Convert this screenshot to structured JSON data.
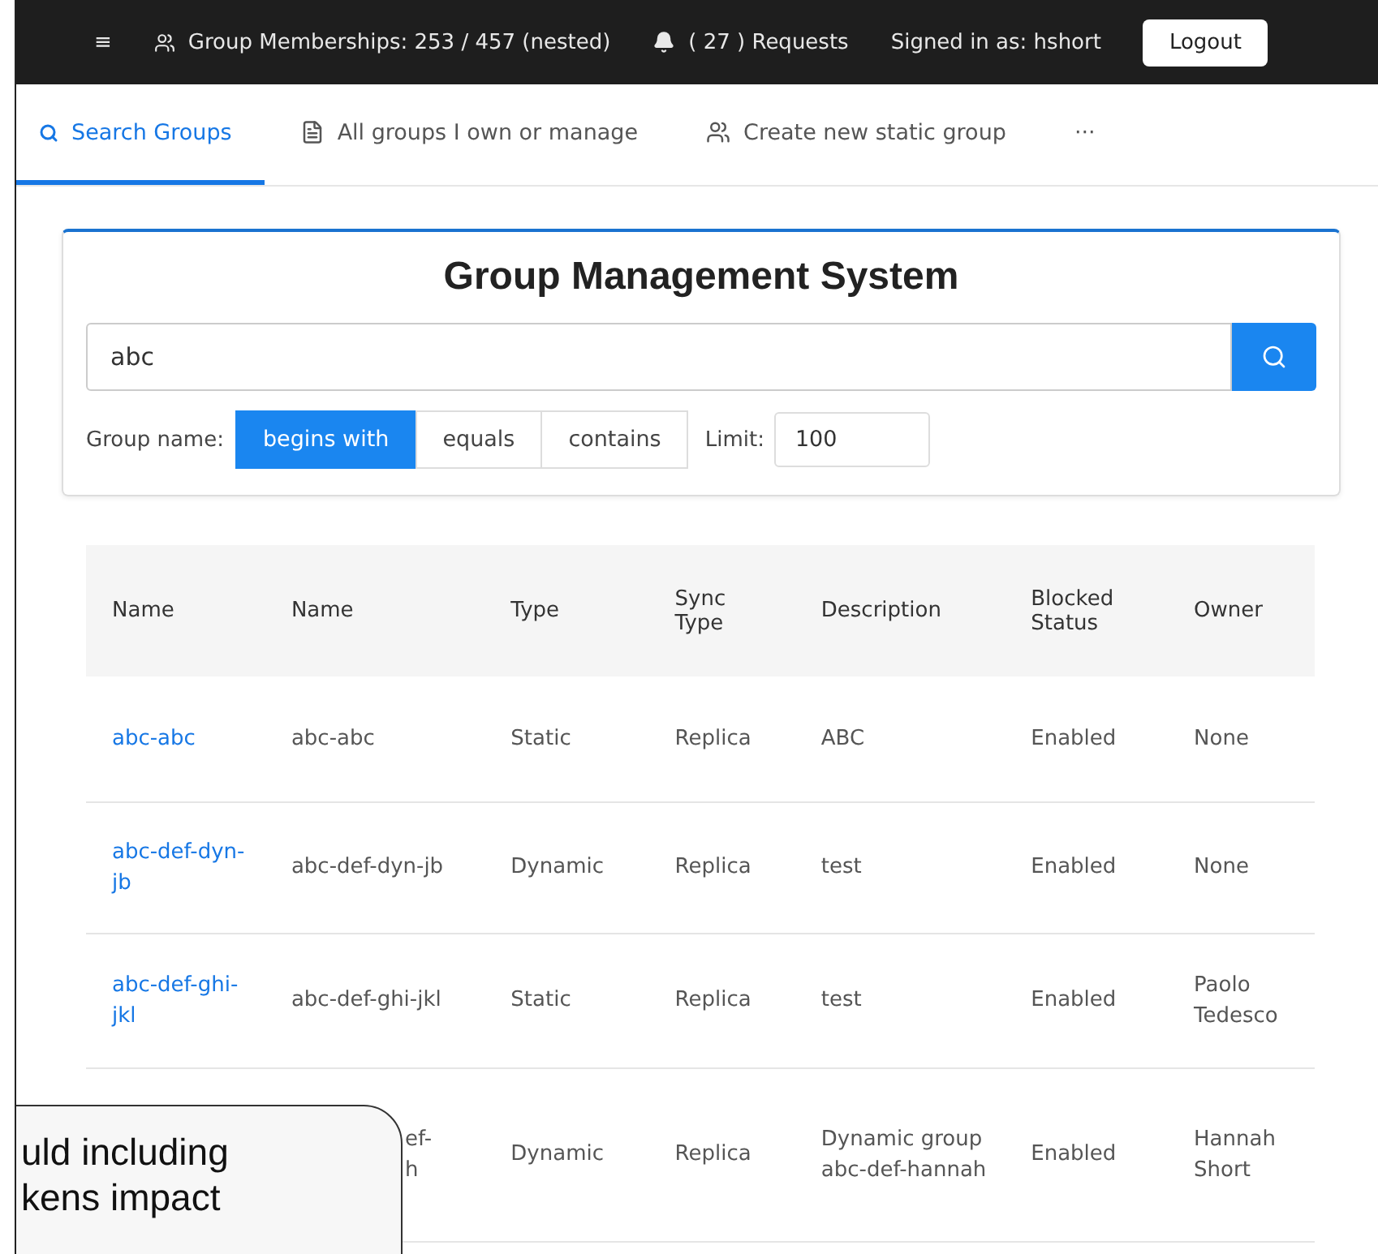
{
  "top_bar": {
    "menu_glyph": "≡",
    "memberships": "Group Memberships: 253 / 457 (nested)",
    "requests": "( 27 ) Requests",
    "signed_in": "Signed in as: hshort",
    "logout": "Logout"
  },
  "tabs": [
    {
      "label": "Search Groups",
      "kind": "search",
      "selected": true
    },
    {
      "label": "All groups I own or manage",
      "kind": "owned",
      "selected": false
    },
    {
      "label": "Create new static group",
      "kind": "create",
      "selected": false
    },
    {
      "label": "···",
      "kind": "more",
      "selected": false
    }
  ],
  "search": {
    "title": "Group Management System",
    "value": "abc",
    "match_label": "Group name:",
    "match_options": [
      {
        "label": "begins with",
        "selected": true
      },
      {
        "label": "equals",
        "selected": false
      },
      {
        "label": "contains",
        "selected": false
      }
    ],
    "limit_label": "Limit:",
    "limit_value": "100"
  },
  "table": {
    "columns": [
      "Name",
      "Name",
      "Type",
      "Sync Type",
      "Description",
      "Blocked Status",
      "Owner"
    ],
    "rows": [
      [
        "abc-abc",
        "abc-abc",
        "Static",
        "Replica",
        "ABC",
        "Enabled",
        "None"
      ],
      [
        "abc-def-dyn-jb",
        "abc-def-dyn-jb",
        "Dynamic",
        "Replica",
        "test",
        "Enabled",
        "None"
      ],
      [
        "abc-def-ghi-jkl",
        "abc-def-ghi-jkl",
        "Static",
        "Replica",
        "test",
        "Enabled",
        "Paolo Tedesco"
      ],
      [
        "",
        "ef-\nh",
        "Dynamic",
        "Replica",
        "Dynamic group abc-def-hannah",
        "Enabled",
        "Hannah Short"
      ]
    ]
  },
  "callout": {
    "lines": [
      "uld including",
      "kens impact"
    ]
  }
}
